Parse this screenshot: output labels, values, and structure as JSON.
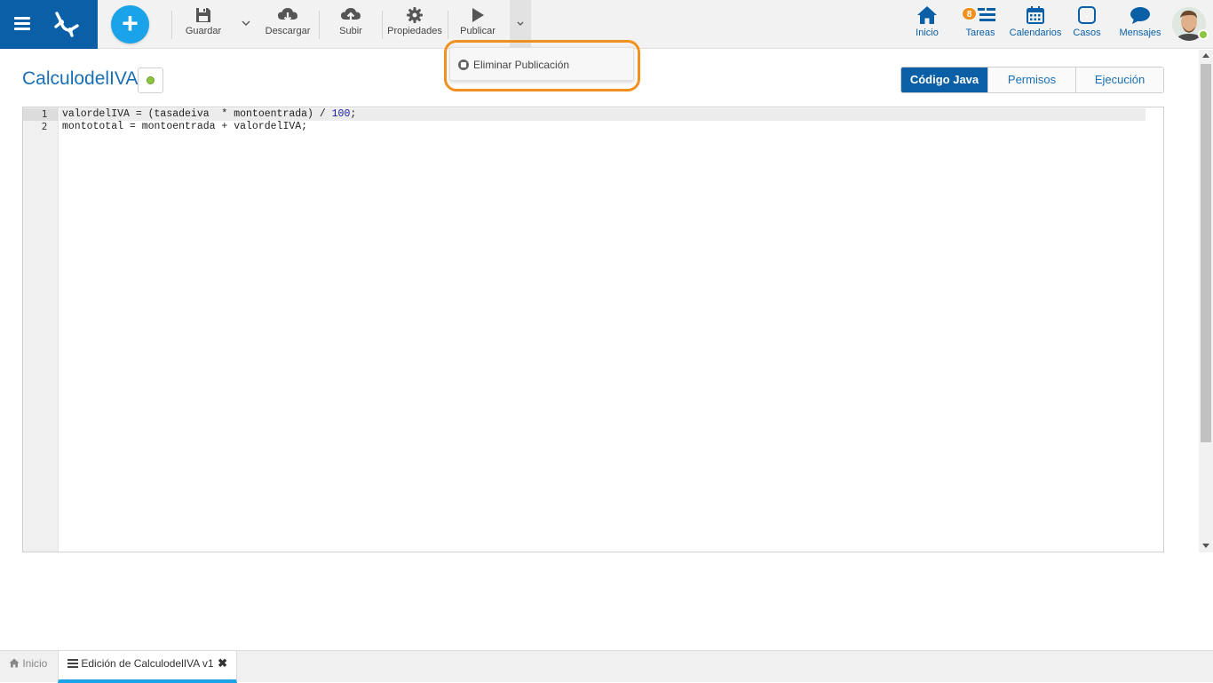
{
  "toolbar": {
    "save_label": "Guardar",
    "download_label": "Descargar",
    "upload_label": "Subir",
    "properties_label": "Propiedades",
    "publish_label": "Publicar"
  },
  "publish_menu": {
    "items": [
      {
        "label": "Eliminar Publicación",
        "icon": "stop-circle-icon"
      }
    ]
  },
  "nav": {
    "home_label": "Inicio",
    "tasks_label": "Tareas",
    "tasks_badge": "8",
    "calendars_label": "Calendarios",
    "cases_label": "Casos",
    "messages_label": "Mensajes"
  },
  "page": {
    "title": "CalculodelIVA"
  },
  "tabs": [
    {
      "label": "Código Java",
      "active": true
    },
    {
      "label": "Permisos",
      "active": false
    },
    {
      "label": "Ejecución",
      "active": false
    }
  ],
  "editor": {
    "lines": [
      {
        "number": "1",
        "code": "valordelIVA = (tasadeiva  * montoentrada) / ",
        "literal": "100",
        "tail": ";"
      },
      {
        "number": "2",
        "code": "montototal = montoentrada + valordelIVA;",
        "literal": "",
        "tail": ""
      }
    ]
  },
  "bottom_tabs": {
    "home_label": "Inicio",
    "edit_label": "Edición de CalculodelIVA v1"
  },
  "colors": {
    "brand": "#0a5fa6",
    "accent": "#1aa3e8",
    "highlight": "#f0901e",
    "status": "#8cc63f"
  }
}
